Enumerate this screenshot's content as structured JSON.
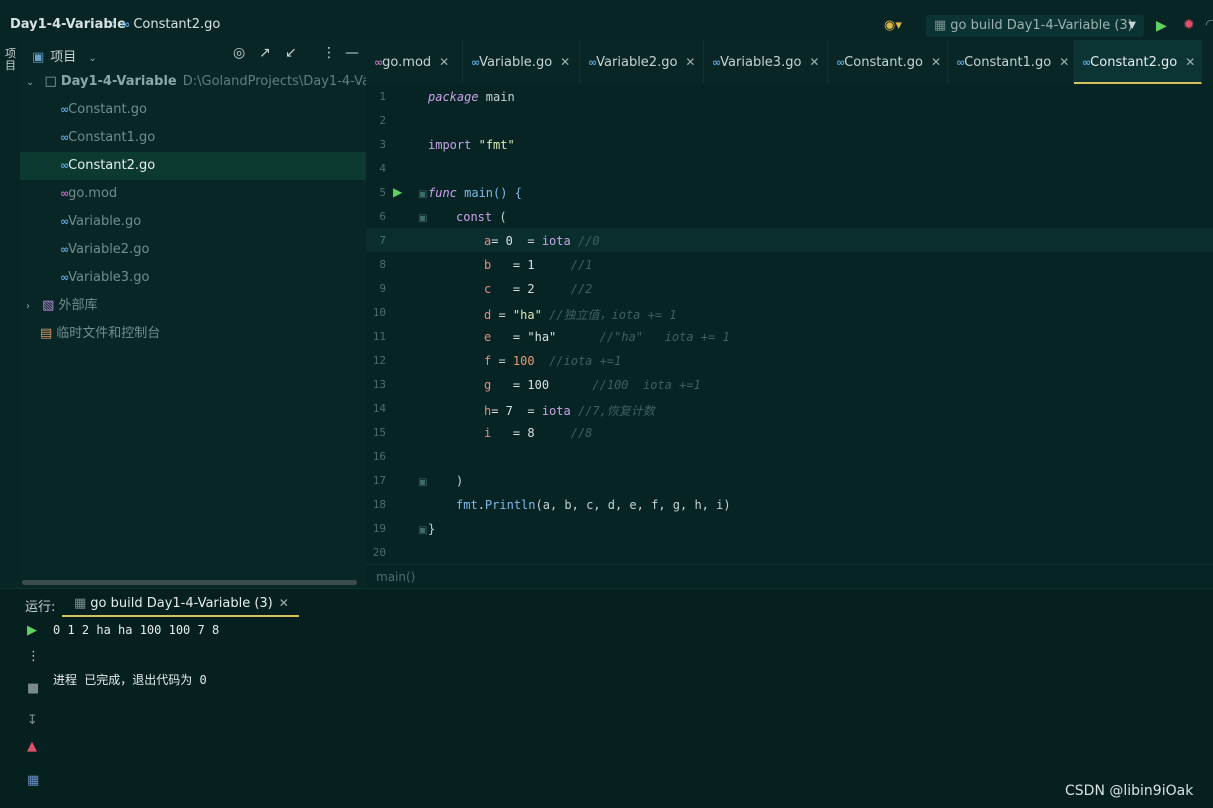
{
  "breadcrumb": {
    "project": "Day1-4-Variable",
    "separator": "›",
    "file": "Constant2.go"
  },
  "toolbar": {
    "run_config": "go build Day1-4-Variable (3)",
    "user_icon": "users-icon",
    "run_icon": "play-icon",
    "debug_icon": "bug-icon"
  },
  "left_strip": {
    "project_tab": "项目"
  },
  "project_panel": {
    "title": "项目",
    "root": {
      "name": "Day1-4-Variable",
      "path": "D:\\GolandProjects\\Day1-4-Variable"
    },
    "files": [
      "Constant.go",
      "Constant1.go",
      "Constant2.go",
      "go.mod",
      "Variable.go",
      "Variable2.go",
      "Variable3.go"
    ],
    "selected_file": "Constant2.go",
    "external_libs": "外部库",
    "scratches": "临时文件和控制台"
  },
  "editor": {
    "tabs": [
      {
        "label": "go.mod",
        "icon": "mod"
      },
      {
        "label": "Variable.go",
        "icon": "go"
      },
      {
        "label": "Variable2.go",
        "icon": "go"
      },
      {
        "label": "Variable3.go",
        "icon": "go"
      },
      {
        "label": "Constant.go",
        "icon": "go"
      },
      {
        "label": "Constant1.go",
        "icon": "go"
      },
      {
        "label": "Constant2.go",
        "icon": "go"
      }
    ],
    "active_tab": "Constant2.go",
    "line_numbers": [
      "1",
      "2",
      "3",
      "4",
      "5",
      "6",
      "7",
      "8",
      "9",
      "10",
      "11",
      "12",
      "13",
      "14",
      "15",
      "16",
      "17",
      "18",
      "19",
      "20"
    ],
    "code": {
      "l1_kw": "package",
      "l1_rest": " main",
      "l3_kw": "import",
      "l3_str": "\"fmt\"",
      "l5_kw": "func",
      "l5_rest": " main() {",
      "l6_kw": "const",
      "l6_rest": " (",
      "l7": {
        "id": "a",
        "hint": "= 0",
        "op": "= ",
        "val": "iota",
        "comment": "//0"
      },
      "l8": {
        "id": "b",
        "hint": "= 1",
        "comment": "//1"
      },
      "l9": {
        "id": "c",
        "hint": "= 2",
        "comment": "//2"
      },
      "l10": {
        "id": "d",
        "op": " = ",
        "val": "\"ha\"",
        "comment": "//独立值，iota += 1"
      },
      "l11": {
        "id": "e",
        "hint": "= \"ha\"",
        "comment": "//\"ha\"   iota += 1"
      },
      "l12": {
        "id": "f",
        "op": " = ",
        "val": "100",
        "comment": "//iota +=1"
      },
      "l13": {
        "id": "g",
        "hint": "= 100",
        "comment": "//100  iota +=1"
      },
      "l14": {
        "id": "h",
        "hint": "= 7",
        "op": "= ",
        "val": "iota",
        "comment": "//7,恢复计数"
      },
      "l15": {
        "id": "i",
        "hint": "= 8",
        "comment": "//8"
      },
      "l17": ")",
      "l18_pkg": "fmt",
      "l18_fn": "Println",
      "l18_args": "(a, b, c, d, e, f, g, h, i)",
      "l19": "}"
    },
    "footer_breadcrumb": "main()"
  },
  "run_panel": {
    "label": "运行:",
    "tab": "go build Day1-4-Variable (3)",
    "output_line1": "0 1 2 ha ha 100 100 7 8",
    "output_line2": "进程 已完成，退出代码为 0"
  },
  "watermark": "CSDN @libin9iOak"
}
